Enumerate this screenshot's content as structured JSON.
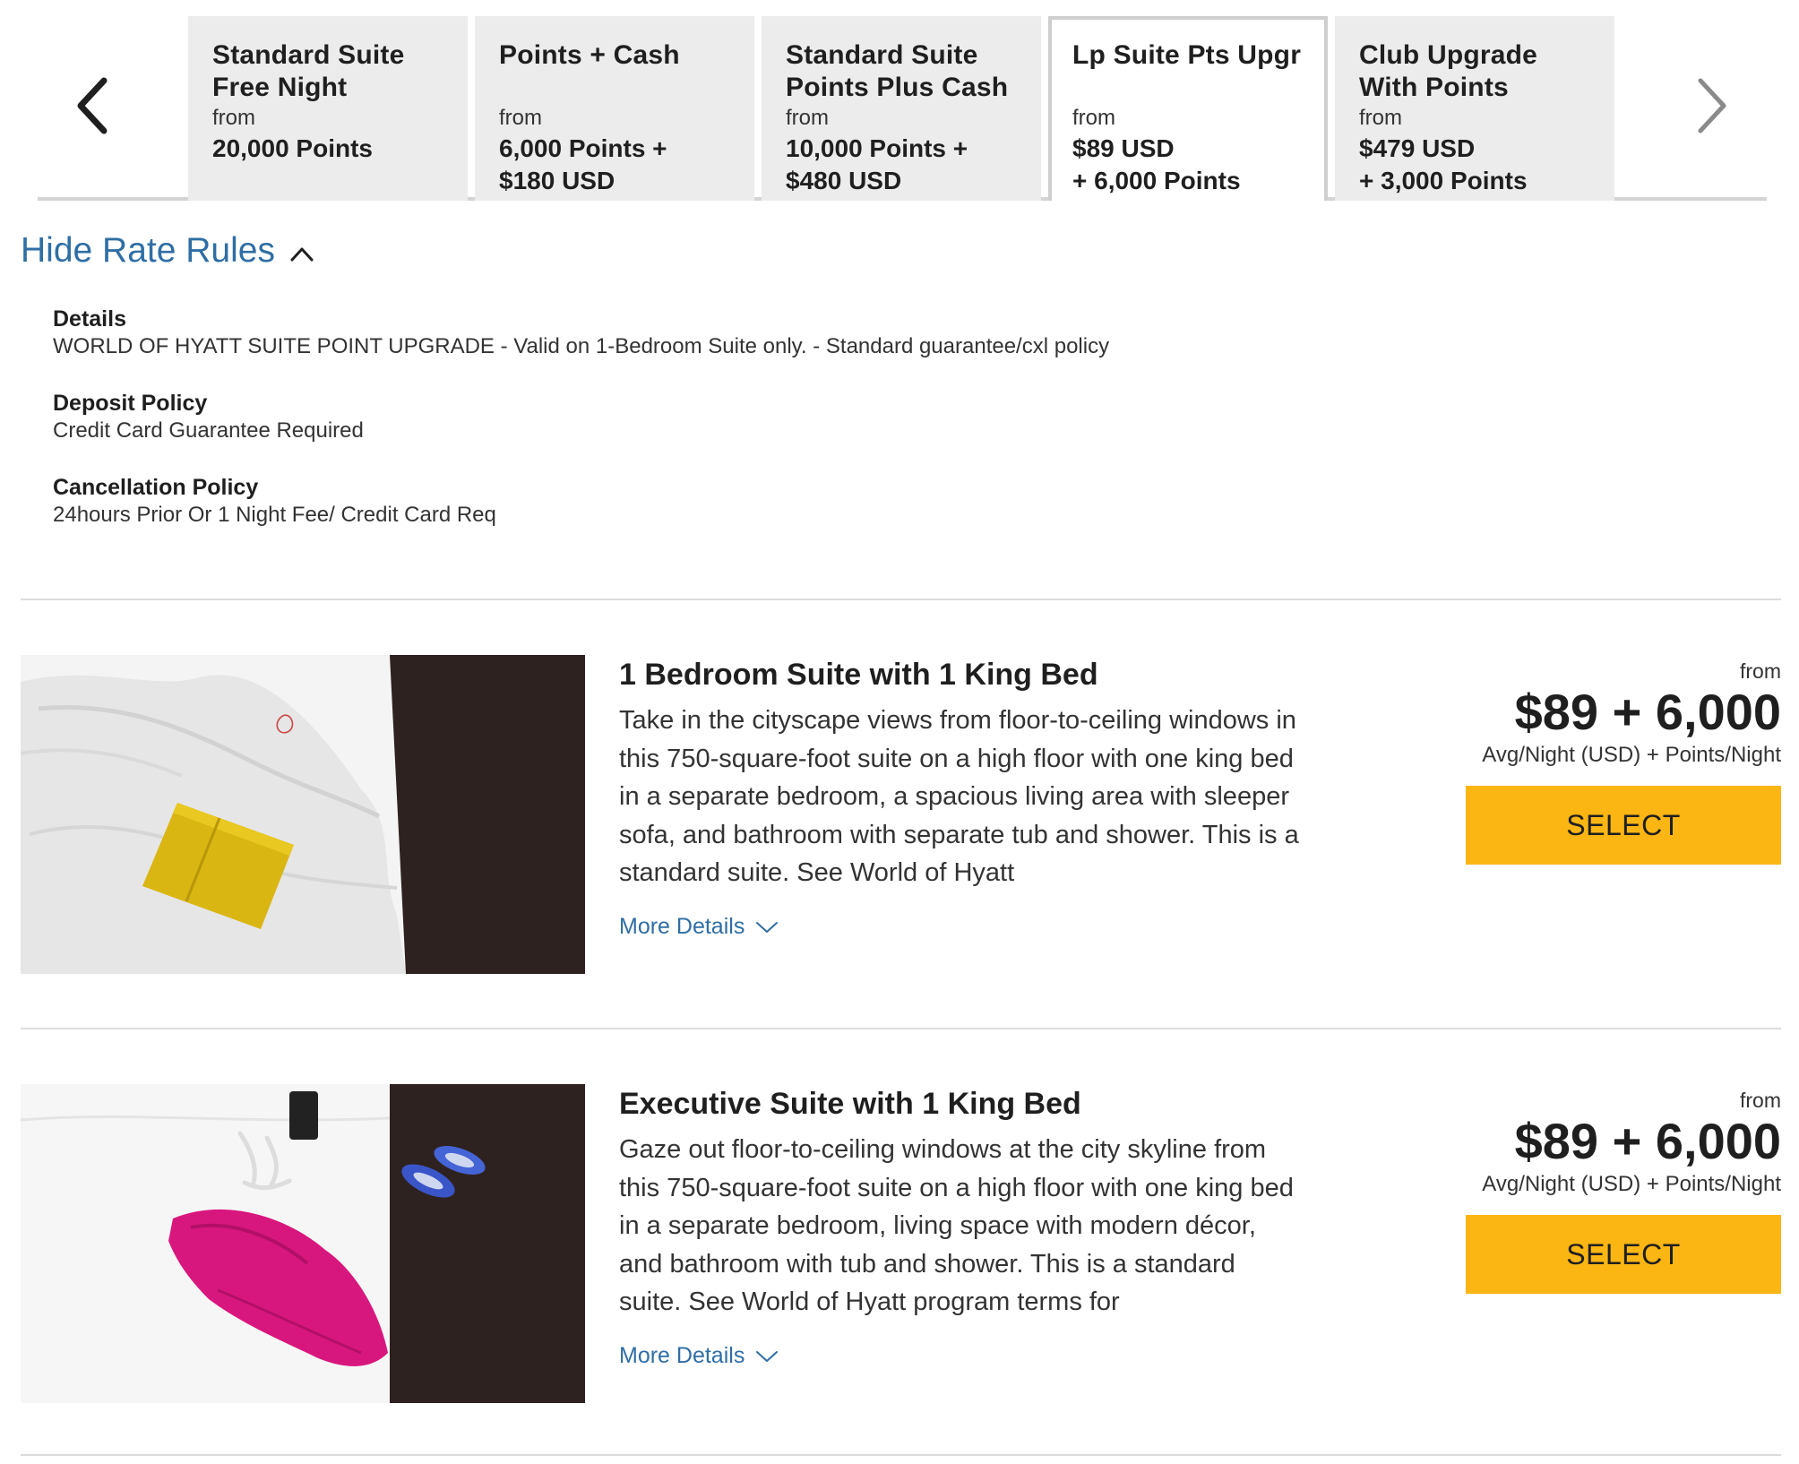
{
  "rate_tabs": [
    {
      "title": "Standard Suite Free Night",
      "from_label": "from",
      "price": "20,000 Points",
      "active": false
    },
    {
      "title": "Points + Cash",
      "from_label": "from",
      "price": "6,000 Points +\n$180 USD",
      "active": false
    },
    {
      "title": "Standard Suite Points Plus Cash",
      "from_label": "from",
      "price": "10,000 Points +\n$480 USD",
      "active": false
    },
    {
      "title": "Lp Suite Pts Upgr",
      "from_label": "from",
      "price": "$89 USD\n+ 6,000 Points",
      "active": true
    },
    {
      "title": "Club Upgrade With Points",
      "from_label": "from",
      "price": "$479 USD\n+ 3,000 Points",
      "active": false
    }
  ],
  "carousel": {
    "prev_icon": "chevron-left-icon",
    "next_icon": "chevron-right-icon",
    "prev_enabled": true,
    "next_enabled": false
  },
  "rate_rules": {
    "toggle_label": "Hide Rate Rules",
    "toggle_icon": "chevron-up-icon",
    "details_label": "Details",
    "details_text": "WORLD OF HYATT SUITE POINT UPGRADE - Valid on 1-Bedroom Suite only. - Standard guarantee/cxl policy",
    "deposit_label": "Deposit Policy",
    "deposit_text": "Credit Card Guarantee Required",
    "cancellation_label": "Cancellation Policy",
    "cancellation_text": "24hours Prior Or 1 Night Fee/ Credit Card Req"
  },
  "rooms": [
    {
      "name": "1 Bedroom Suite with 1 King Bed",
      "description": "Take in the cityscape views from floor-to-ceiling windows in this 750-square-foot suite on a high floor with one king bed in a separate bedroom, a spacious living area with sleeper sofa, and bathroom with separate tub and shower. This is a standard suite.  See World of Hyatt",
      "more_details_label": "More Details",
      "from_label": "from",
      "price": "$89 + 6,000",
      "price_unit": "Avg/Night (USD) + Points/Night",
      "select_label": "SELECT"
    },
    {
      "name": "Executive Suite with 1 King Bed",
      "description": "Gaze out floor-to-ceiling windows at the city skyline from this 750-square-foot suite on a high floor with one king bed in a separate bedroom, living space with modern décor, and bathroom with tub and shower. This is a standard suite.  See World of Hyatt program terms for",
      "more_details_label": "More Details",
      "from_label": "from",
      "price": "$89 + 6,000",
      "price_unit": "Avg/Night (USD) + Points/Night",
      "select_label": "SELECT"
    }
  ],
  "colors": {
    "accent_link": "#2f6ea5",
    "select_button": "#fbb614",
    "tab_inactive": "#ececec"
  }
}
